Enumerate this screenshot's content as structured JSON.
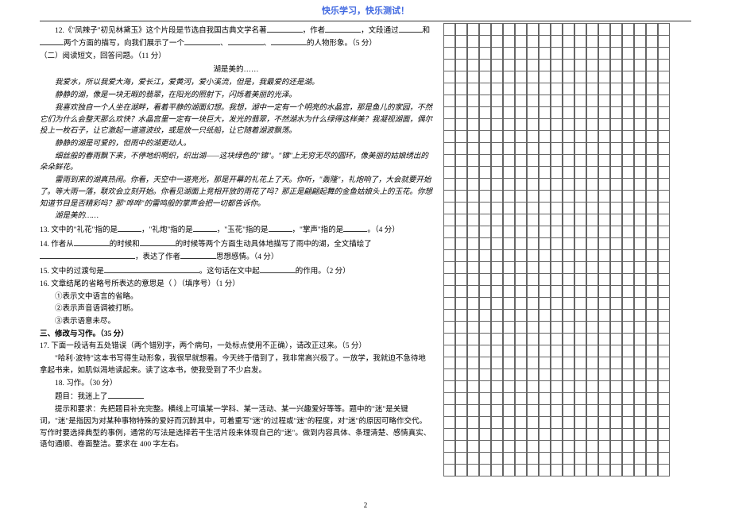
{
  "header": {
    "title": "快乐学习，快乐测试！"
  },
  "left": {
    "q12_pre": "12.《\"凤辣子\"初见林黛玉》这个片段是节选自我国古典文学名著",
    "q12_mid1": "，作者",
    "q12_mid2": "，文段通过",
    "q12_mid3": "和",
    "q12_mid4": "两个方面的描写，向我们展示了一个",
    "q12_mid5": "、",
    "q12_mid6": "、",
    "q12_end": "的人物形象。（5 分）",
    "section2": "（二）阅读短文，回答问题。（11 分）",
    "passage_title": "湖是美的……",
    "p1": "我爱水，所以我爱大海，爱长江，爱黄河，爱小溪流，但是，我最爱的还是湖。",
    "p2": "静静的湖，像是一块无暇的翡翠，在阳光的照射下，闪烁着美丽的光泽。",
    "p3": "我喜欢独自一个人坐在湖畔，看着平静的湖面幻想。我想，湖中一定有一个明亮的水晶宫，那是鱼儿的家园，不然它们为什么会整天那么欢快？水晶宫里一定有一块巨大，发光的翡翠，不然湖水为什么绿得这样美？我凝视湖面，偶尔投上一枚石子，让它激起一道道波纹，或是放一只纸船，让它随着湖波飘荡。",
    "p4": "静静的湖是可爱的，但雨中的湖更动人。",
    "p5": "细丝般的春雨飘下来，不停地织啊织，织出湖——这块绿色的\"锦\"。\"锦\"上无穷无尽的圆环，像美丽的姑娘绣出的朵朵鲜花。",
    "p6": "雷雨到来的湖真热闹。你看，天空中一道亮光，那是开幕的礼花上了天。你听，\"轰隆\"，礼炮响了，大会就要开始了。等大雨一落，联欢会立刻开始。你看见湖面上竞相开放的雨花了吗？那正是翩翩起舞的金鱼姑娘头上的玉花。你想知道节目是否精彩吗？那\"哗哗\"的雷鸣般的掌声会把一切都告诉你。",
    "p7": "湖是美的……",
    "q13_pre": "13. 文中的\"礼花\"指的是",
    "q13_m1": "，\"礼炮\"指的是",
    "q13_m2": "，\"玉花\"指的是",
    "q13_m3": "，\"掌声\"指的是",
    "q13_end": "。（4 分）",
    "q14_pre": "14.  作者从",
    "q14_m1": "的时候和",
    "q14_m2": "的时候等两个方面生动具体地描写了雨中的湖，全文描绘了",
    "q14_m3": "，表达了作者",
    "q14_end": "思想感情。（4 分）",
    "q15_pre": "15. 文中的过渡句是",
    "q15_m1": "。这句话在文中起",
    "q15_end": "的作用。（2 分）",
    "q16": "16. 文章结尾的省略号所表达的意思是（    ）（填序号）（1 分）",
    "q16_o1": "①表示文中语言的省略。",
    "q16_o2": "②表示声音语调被打断。",
    "q16_o3": "③表示语意未尽。",
    "sec3": "三、修改与习作。（35 分）",
    "q17_head": "17. 下面一段话有五处错误（两个错别字，两个病句，一处标点使用不正确），请改正过来。（5 分）",
    "q17_body": "\"哈利·波特\"这本书写得生动形象，我很早就想看。今天终于借到了，我非常高兴极了。一放学，我就迫不急待地拿起书来，如肌似渴地读起来。读了这本书，使我受到了不少启发。",
    "q18_head": "18. 习作。（30 分）",
    "q18_topic": "题目：我迷上了",
    "q18_hint": "提示和要求：先把题目补充完整。横线上可填某一学科、某一活动、某一兴趣爱好等等。题中的\"迷\"是关键词，\"迷\"是指因为对某种事物特殊的爱好而沉醉其中，可着重写\"迷\"的过程或\"迷\"的程度，对\"迷\"的原因可略作交代。写作时要选择典型的事例，通常的写法是选择若干生活片段来体现自己的\"迷\"。做到内容具体、条理清楚、感情真实、语句通顺、卷面整洁。要求在 400 字左右。"
  },
  "footer": {
    "page_number": "2"
  }
}
